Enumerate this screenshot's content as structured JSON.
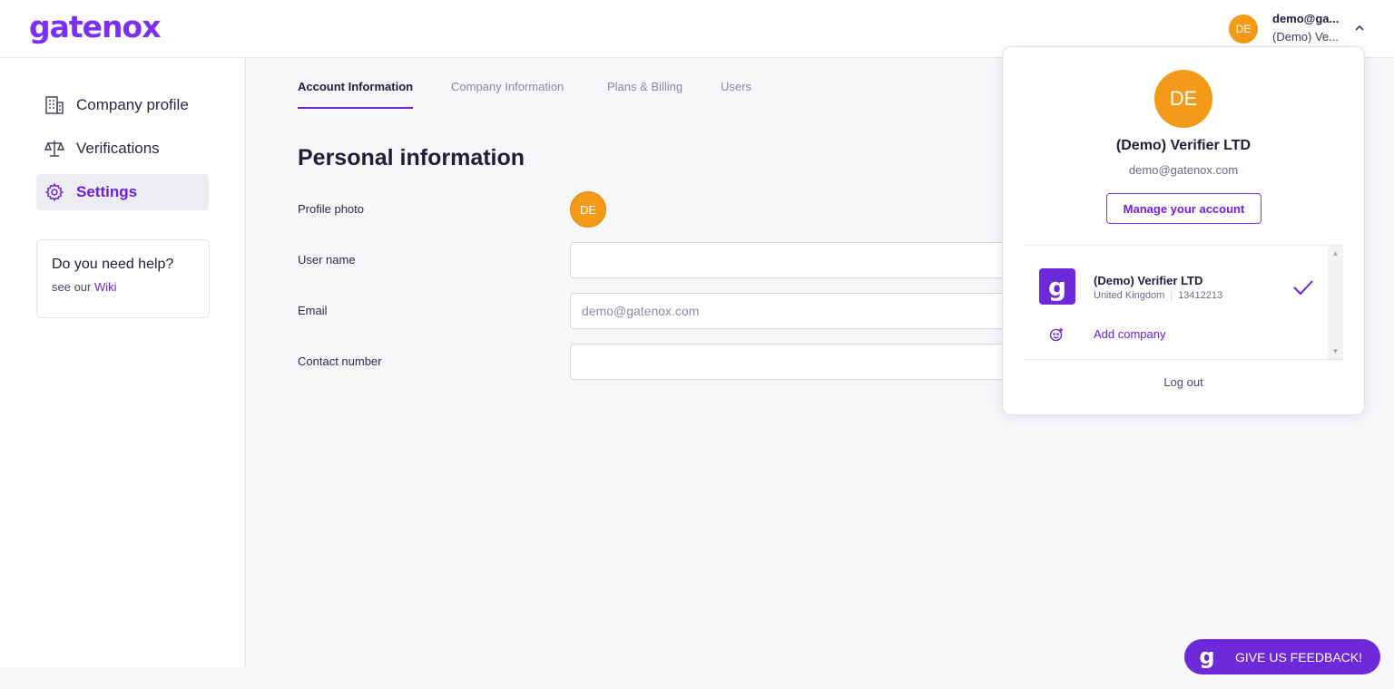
{
  "header": {
    "logo": "gatenox",
    "user_email": "demo@ga...",
    "user_company": "(Demo) Ve...",
    "avatar_initials": "DE"
  },
  "sidebar": {
    "items": [
      {
        "label": "Company profile",
        "icon": "building-icon"
      },
      {
        "label": "Verifications",
        "icon": "scales-icon"
      },
      {
        "label": "Settings",
        "icon": "gear-icon",
        "active": true
      }
    ],
    "help": {
      "title": "Do you need help?",
      "prefix": "see our",
      "link": "Wiki"
    }
  },
  "main": {
    "tabs": [
      "Account Information",
      "Company Information",
      "Plans & Billing",
      "Users"
    ],
    "active_tab": "Account Information",
    "section_title": "Personal information",
    "fields": {
      "profile_photo_label": "Profile photo",
      "avatar_initials": "DE",
      "user_name_label": "User name",
      "user_name_value": "",
      "email_label": "Email",
      "email_placeholder": "demo@gatenox.com",
      "contact_label": "Contact number",
      "contact_value": ""
    }
  },
  "dropdown": {
    "avatar_initials": "DE",
    "company": "(Demo) Verifier LTD",
    "email": "demo@gatenox.com",
    "manage_label": "Manage your account",
    "companies": [
      {
        "name": "(Demo) Verifier LTD",
        "country": "United Kingdom",
        "number": "13412213",
        "logo_letter": "g",
        "selected": true
      }
    ],
    "add_company_label": "Add company",
    "logout_label": "Log out"
  },
  "feedback": {
    "label": "GIVE US FEEDBACK!",
    "logo_letter": "g"
  },
  "colors": {
    "brand": "#6b21d9",
    "avatar": "#f39a18"
  }
}
